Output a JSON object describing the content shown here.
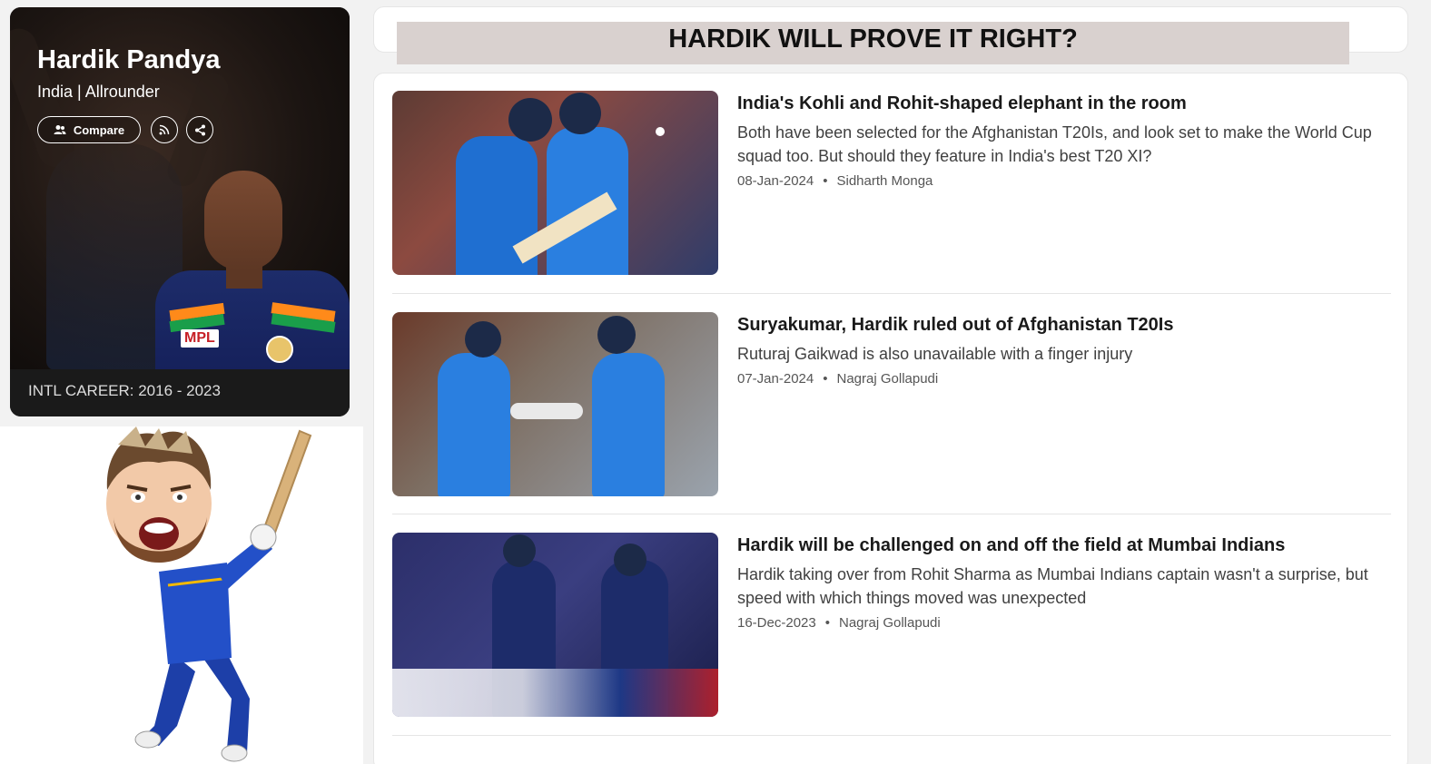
{
  "player": {
    "name": "Hardik Pandya",
    "role": "India | Allrounder",
    "compare_label": "Compare",
    "career": "INTL CAREER: 2016 - 2023",
    "jersey_sponsor": "MPL"
  },
  "title": "HARDIK WILL PROVE IT RIGHT?",
  "stories": [
    {
      "headline": "India's Kohli and Rohit-shaped elephant in the room",
      "summary": "Both have been selected for the Afghanistan T20Is, and look set to make the World Cup squad too. But should they feature in India's best T20 XI?",
      "date": "08-Jan-2024",
      "author": "Sidharth Monga"
    },
    {
      "headline": "Suryakumar, Hardik ruled out of Afghanistan T20Is",
      "summary": "Ruturaj Gaikwad is also unavailable with a finger injury",
      "date": "07-Jan-2024",
      "author": "Nagraj Gollapudi"
    },
    {
      "headline": "Hardik will be challenged on and off the field at Mumbai Indians",
      "summary": "Hardik taking over from Rohit Sharma as Mumbai Indians captain wasn't a surprise, but speed with which things moved was unexpected",
      "date": "16-Dec-2023",
      "author": "Nagraj Gollapudi"
    }
  ],
  "colors": {
    "india_blue": "#1f6fd1",
    "mi_navy": "#1d2c6a",
    "banner": "#d9d1cf"
  }
}
